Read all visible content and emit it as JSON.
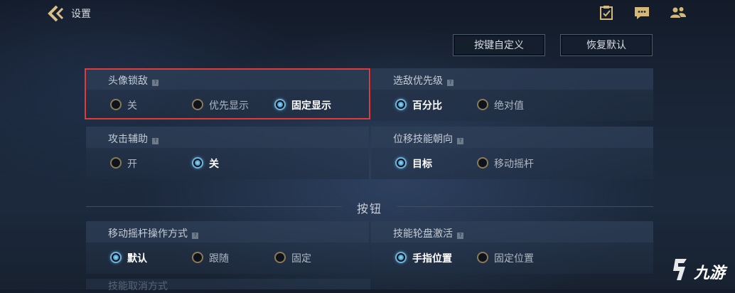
{
  "header": {
    "back_icon": "chevron-left-icon",
    "title": "设置",
    "icons": [
      "clipboard-check-icon",
      "chat-bubble-icon",
      "friends-icon"
    ]
  },
  "actions": {
    "customize_label": "按键自定义",
    "restore_label": "恢复默认"
  },
  "panels": [
    {
      "label": "头像锁敌",
      "options": [
        {
          "label": "关",
          "selected": false
        },
        {
          "label": "优先显示",
          "selected": false
        },
        {
          "label": "固定显示",
          "selected": true
        }
      ]
    },
    {
      "label": "选敌优先级",
      "options": [
        {
          "label": "百分比",
          "selected": true
        },
        {
          "label": "绝对值",
          "selected": false
        }
      ]
    },
    {
      "label": "攻击辅助",
      "options": [
        {
          "label": "开",
          "selected": false
        },
        {
          "label": "关",
          "selected": true
        }
      ]
    },
    {
      "label": "位移技能朝向",
      "options": [
        {
          "label": "目标",
          "selected": true
        },
        {
          "label": "移动摇杆",
          "selected": false
        }
      ]
    },
    {
      "label": "移动摇杆操作方式",
      "options": [
        {
          "label": "默认",
          "selected": true
        },
        {
          "label": "跟随",
          "selected": false
        },
        {
          "label": "固定",
          "selected": false
        }
      ]
    },
    {
      "label": "技能轮盘激活",
      "options": [
        {
          "label": "手指位置",
          "selected": true
        },
        {
          "label": "固定位置",
          "selected": false
        }
      ]
    }
  ],
  "section": {
    "title": "按钮"
  },
  "cutoff_label": "技能取消方式",
  "help_glyph": "?",
  "watermark": {
    "text": "九游"
  },
  "colors": {
    "highlight": "#e03b3b",
    "radio_selected": "#6fb3d9",
    "radio_unselected": "#8a7a58"
  }
}
